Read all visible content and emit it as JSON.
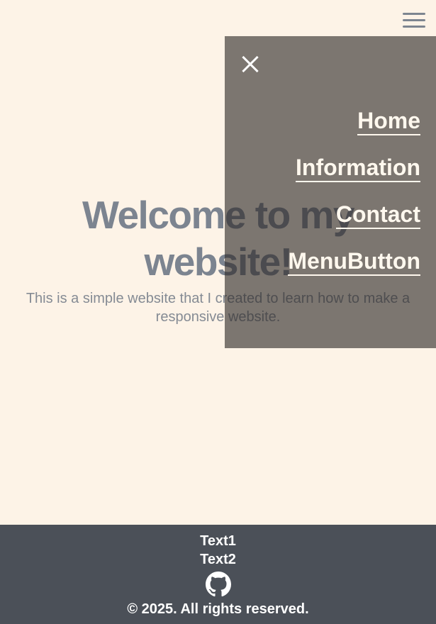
{
  "header": {
    "menu_icon": "hamburger-menu-icon"
  },
  "hero": {
    "title": "Welcome to my website!",
    "text": "This is a simple website that I created to learn how to make a responsive website."
  },
  "menu": {
    "close_icon": "close-icon",
    "items": [
      {
        "label": "Home"
      },
      {
        "label": "Information"
      },
      {
        "label": "Contact"
      },
      {
        "label": "MenuButton"
      }
    ]
  },
  "footer": {
    "text1": "Text1",
    "text2": "Text2",
    "icon": "github-icon",
    "copyright": "© 2025. All rights reserved."
  },
  "colors": {
    "page_background": "#fdf3e7",
    "menu_overlay": "rgba(45,40,38,0.62)",
    "footer_background": "#4b5058",
    "menu_text": "#fff8ee"
  }
}
